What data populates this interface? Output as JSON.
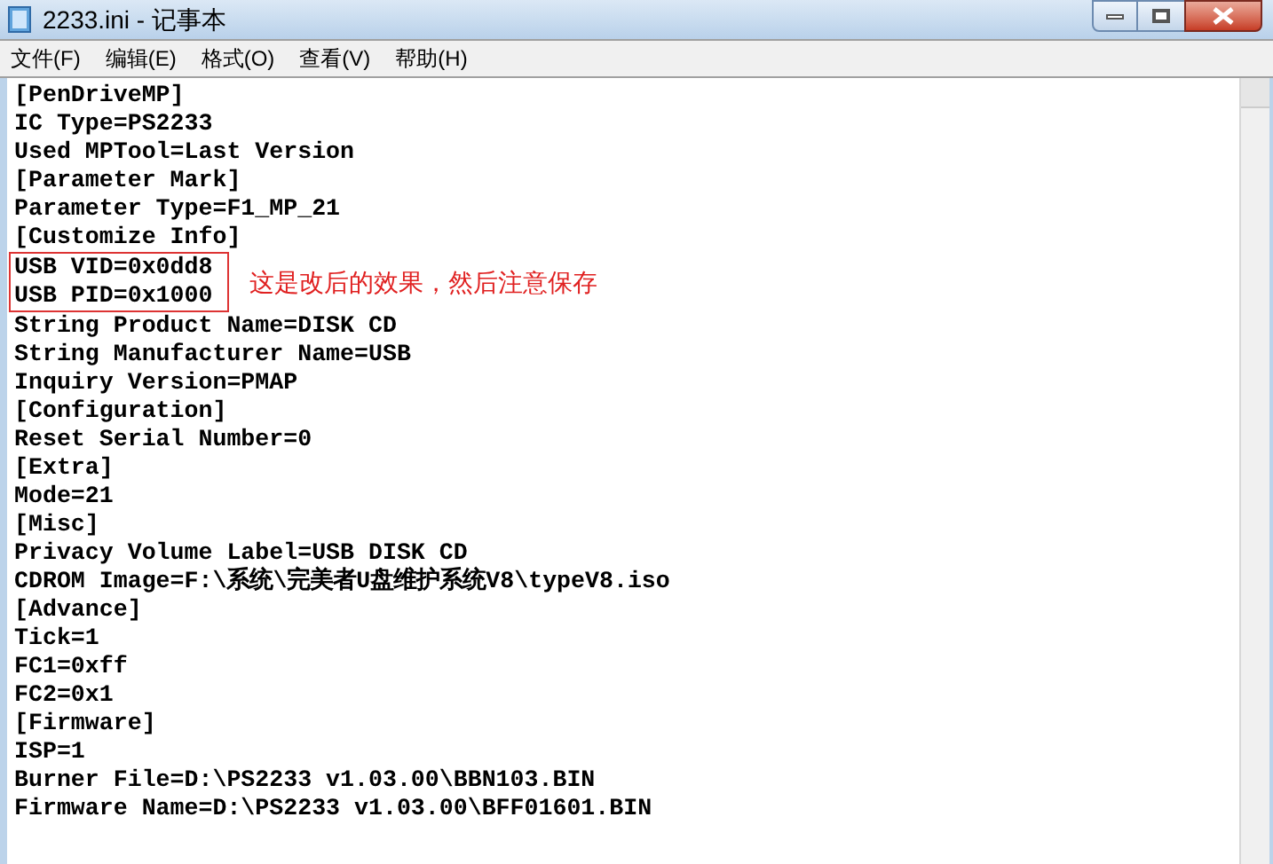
{
  "window": {
    "title": "2233.ini - 记事本"
  },
  "menu": [
    {
      "label": "文件(F)"
    },
    {
      "label": "编辑(E)"
    },
    {
      "label": "格式(O)"
    },
    {
      "label": "查看(V)"
    },
    {
      "label": "帮助(H)"
    }
  ],
  "lines": [
    {
      "text": "[PenDriveMP]",
      "boxed": false
    },
    {
      "text": "IC Type=PS2233",
      "boxed": false
    },
    {
      "text": "Used MPTool=Last Version",
      "boxed": false
    },
    {
      "text": "[Parameter Mark]",
      "boxed": false
    },
    {
      "text": "Parameter Type=F1_MP_21",
      "boxed": false
    },
    {
      "text": "[Customize Info]",
      "boxed": false
    },
    {
      "text": "USB VID=0x0dd8",
      "boxed": true
    },
    {
      "text": "USB PID=0x1000",
      "boxed": true
    },
    {
      "text": "String Product Name=DISK CD",
      "boxed": false
    },
    {
      "text": "String Manufacturer Name=USB",
      "boxed": false
    },
    {
      "text": "Inquiry Version=PMAP",
      "boxed": false
    },
    {
      "text": "[Configuration]",
      "boxed": false
    },
    {
      "text": "Reset Serial Number=0",
      "boxed": false
    },
    {
      "text": "[Extra]",
      "boxed": false
    },
    {
      "text": "Mode=21",
      "boxed": false
    },
    {
      "text": "[Misc]",
      "boxed": false
    },
    {
      "text": "Privacy Volume Label=USB DISK CD",
      "boxed": false
    },
    {
      "text": "CDROM Image=F:\\系统\\完美者U盘维护系统V8\\typeV8.iso",
      "boxed": false
    },
    {
      "text": "[Advance]",
      "boxed": false
    },
    {
      "text": "Tick=1",
      "boxed": false
    },
    {
      "text": "FC1=0xff",
      "boxed": false
    },
    {
      "text": "FC2=0x1",
      "boxed": false
    },
    {
      "text": "[Firmware]",
      "boxed": false
    },
    {
      "text": "ISP=1",
      "boxed": false
    },
    {
      "text": "Burner File=D:\\PS2233 v1.03.00\\BBN103.BIN",
      "boxed": false
    },
    {
      "text": "Firmware Name=D:\\PS2233 v1.03.00\\BFF01601.BIN",
      "boxed": false
    }
  ],
  "annotation": {
    "text": "这是改后的效果，然后注意保存"
  }
}
